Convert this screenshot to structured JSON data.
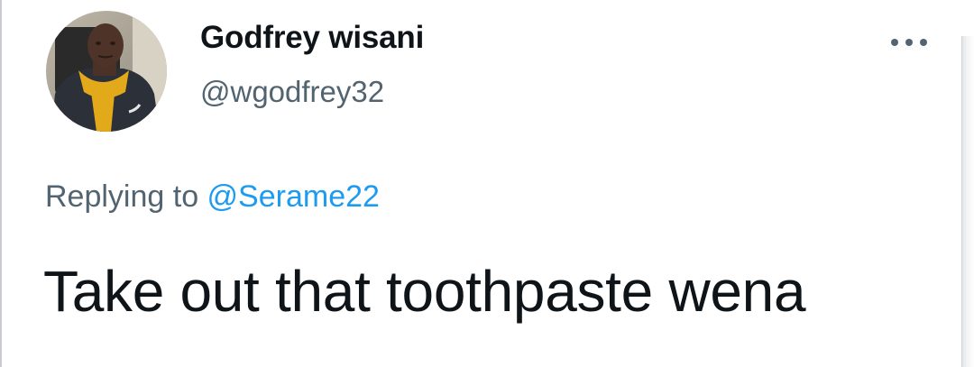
{
  "tweet": {
    "author": {
      "display_name": "Godfrey wisani",
      "handle": "@wgodfrey32"
    },
    "reply_context": {
      "prefix": "Replying to ",
      "mention": "@Serame22"
    },
    "text": "Take out that toothpaste wena",
    "more_icon": "more-horizontal-icon"
  },
  "colors": {
    "text_primary": "#0f1419",
    "text_secondary": "#536471",
    "link": "#1d9bf0",
    "background": "#ffffff"
  }
}
